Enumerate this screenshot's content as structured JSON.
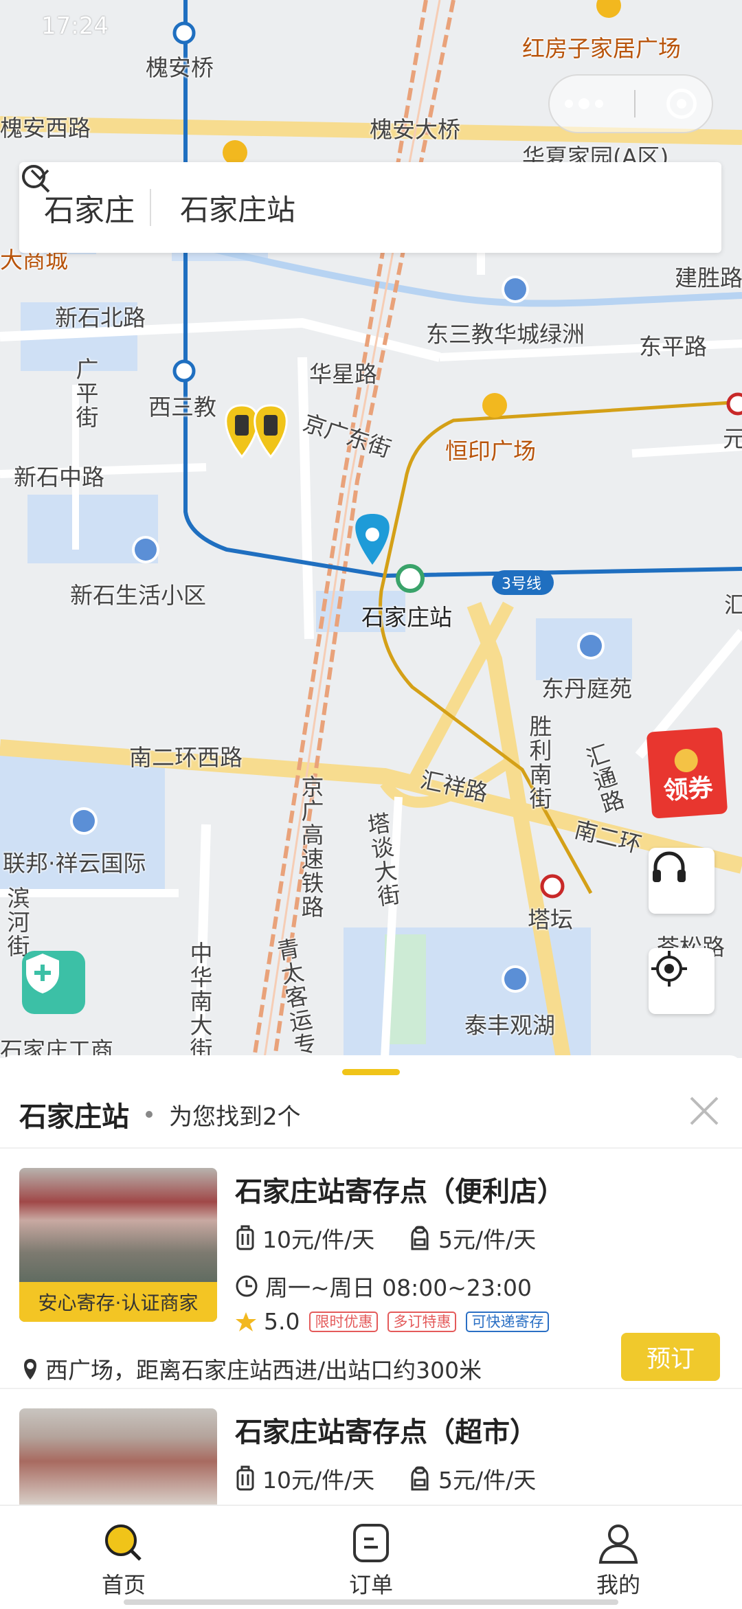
{
  "status_bar": {
    "time": "17:24"
  },
  "map": {
    "labels": {
      "huaian_qiao": "槐安桥",
      "huaian_xilu": "槐安西路",
      "huaian_daqiao": "槐安大桥",
      "hongfangzi": "红房子家居广场",
      "huaxia_jiayuan": "华夏家园(A区)",
      "xinshi_beilu": "新石北路",
      "dong_sanjiao": "东三教华城绿洲",
      "jiansheng_lu": "建胜路",
      "dongping_lu": "东平路",
      "huaxing_lu": "华星路",
      "xi_sanjiao": "西三教",
      "guangping_jie": "广平街",
      "jingguang_dongjie": "京广东街",
      "hengyin_guangchang": "恒印广场",
      "xinshi_zhonglu": "新石中路",
      "xinshi_shenghuo": "新石生活小区",
      "station": "石家庄站",
      "line3": "3号线",
      "dongdan_tingyuan": "东丹庭苑",
      "nanerhuan_xilu": "南二环西路",
      "huixiang_lu": "汇祥路",
      "shengli_nanjie": "胜利南街",
      "huitong_lu": "汇通路",
      "nanerhuan": "南二环",
      "jinggang_tielu": "京广高速铁路",
      "tatan_dajie": "塔谈大街",
      "tatan": "塔坛",
      "lianbang": "联邦·祥云国际",
      "zhonghua_dajie": "中华南大街",
      "qingtai": "青太客运专线",
      "taifeng": "泰丰观湖",
      "canglang": "苍松路",
      "yuan": "元",
      "hui": "汇",
      "bin_he": "滨河街",
      "shijiazhuang_gongshang": "石家庄工商",
      "da_shangcheng": "大商城"
    }
  },
  "search": {
    "city": "石家庄",
    "query": "石家庄站"
  },
  "coupon": {
    "label": "领券"
  },
  "sheet": {
    "title": "石家庄站",
    "count_text": "为您找到2个",
    "stores": [
      {
        "name": "石家庄站寄存点（便利店）",
        "price_large": "10元/件/天",
        "price_small": "5元/件/天",
        "hours": "周一~周日 08:00~23:00",
        "rating": "5.0",
        "badges": [
          "限时优惠",
          "多订特惠",
          "可快递寄存"
        ],
        "thumb_tag": "安心寄存·认证商家",
        "address": "西广场，距离石家庄站西进/出站口约300米",
        "book_label": "预订"
      },
      {
        "name": "石家庄站寄存点（超市）",
        "price_large": "10元/件/天",
        "price_small": "5元/件/天"
      }
    ]
  },
  "tabs": [
    {
      "label": "首页",
      "icon": "search-icon"
    },
    {
      "label": "订单",
      "icon": "order-icon"
    },
    {
      "label": "我的",
      "icon": "profile-icon"
    }
  ],
  "colors": {
    "accent": "#f0c419",
    "metro_line": "#1f6fc0",
    "line3_orange": "#d4a017",
    "book_button": "#f0c92c",
    "coupon": "#e8362f"
  }
}
